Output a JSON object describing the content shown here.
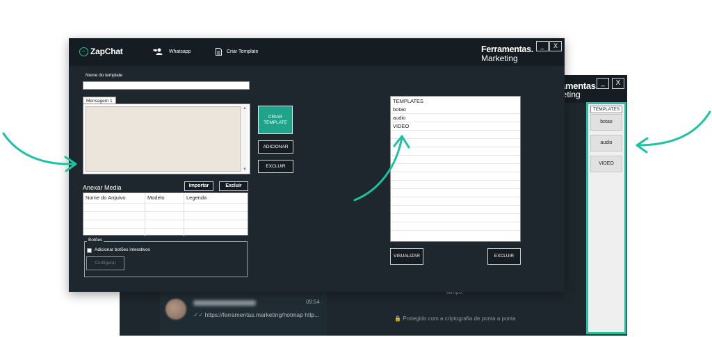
{
  "main_window": {
    "logo": "ZapChat",
    "nav": [
      {
        "label": "Whatsapp",
        "icon": "users-icon"
      },
      {
        "label": "Criar Template",
        "icon": "document-icon"
      }
    ],
    "brand_line1": "Ferramentas.",
    "brand_line2": "Marketing",
    "minimize_label": "_",
    "close_label": "X",
    "template_name_label": "Nome do template",
    "template_name_value": "",
    "message_tab": "Mensagem 1",
    "message_value": "",
    "create_template_button": "CRIAR TEMPLATE",
    "add_button": "ADICIONAR",
    "delete_button": "EXCLUIR",
    "attach_media_title": "Anexar Media",
    "import_button": "Importar",
    "media_delete_button": "Excluir",
    "media_table_columns": [
      "Nome do Arquivo",
      "Modelo",
      "Legenda"
    ],
    "buttons_group_label": "Botões",
    "interactive_buttons_checkbox": "Adicionar botões interativos",
    "interactive_buttons_checked": false,
    "configure_button": "Configurar",
    "templates_list": [
      "TEMPLATES",
      "botao",
      "audio",
      "VIDEO"
    ],
    "view_button": "VISUALIZAR",
    "templates_delete_button": "EXCLUIR"
  },
  "background_window": {
    "brand_line1": "Ferramentas.",
    "brand_line2": "Marketing",
    "minimize_label": "_",
    "close_label": "X",
    "chat_time": "09:54",
    "chat_message": "https://ferramentas.marketing/hotmap http...",
    "right_text_1": "tempo.",
    "right_text_2": "Protegido com a criptografia de ponta a ponta",
    "templates_panel_title": "TEMPLATES",
    "templates_panel_buttons": [
      "botao",
      "audio",
      "VIDEO"
    ]
  },
  "colors": {
    "accent": "#1fc1a3",
    "window_bg": "#1e272d",
    "header_bg": "#151d22"
  }
}
